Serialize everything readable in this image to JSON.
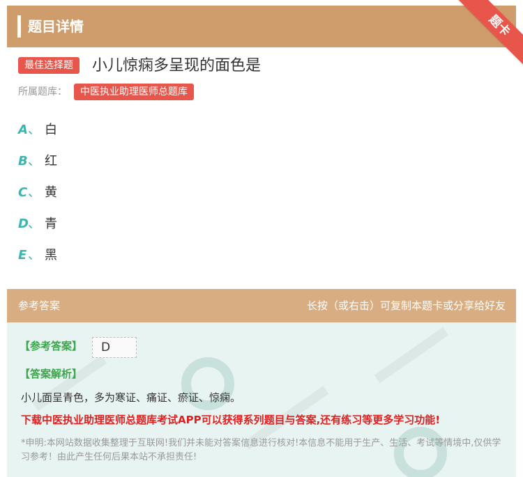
{
  "header": {
    "title": "题目详情"
  },
  "ribbon": {
    "label": "题卡"
  },
  "question": {
    "type_badge": "最佳选择题",
    "text": "小儿惊痫多呈现的面色是",
    "bank_label": "所属题库：",
    "bank_name": "中医执业助理医师总题库"
  },
  "options": [
    {
      "letter": "A",
      "sep": "、",
      "text": "白"
    },
    {
      "letter": "B",
      "sep": "、",
      "text": "红"
    },
    {
      "letter": "C",
      "sep": "、",
      "text": "黄"
    },
    {
      "letter": "D",
      "sep": "、",
      "text": "青"
    },
    {
      "letter": "E",
      "sep": "、",
      "text": "黑"
    }
  ],
  "answer_section": {
    "title": "参考答案",
    "hint": "长按（或右击）可复制本题卡或分享给好友",
    "answer_label": "【参考答案】",
    "answer_value": "D",
    "explanation_label": "【答案解析】",
    "explanation_text": "小儿面呈青色，多为寒证、痛证、瘀证、惊痫。",
    "promo": "下载中医执业助理医师总题库考试APP可以获得系列题目与答案,还有练习等更多学习功能!",
    "disclaimer": "*申明:本网站数据收集整理于互联网!我们并未能对答案信息进行核对!本信息不能用于生产、生活、考试等情境中,仅供学习参考！由此产生任何后果本站不承担责任!"
  },
  "colors": {
    "header_bg": "#cf9c6b",
    "accent_red": "#e8554b",
    "option_teal": "#3ab5b0",
    "answer_green": "#3aa84a",
    "promo_red": "#e02020"
  }
}
